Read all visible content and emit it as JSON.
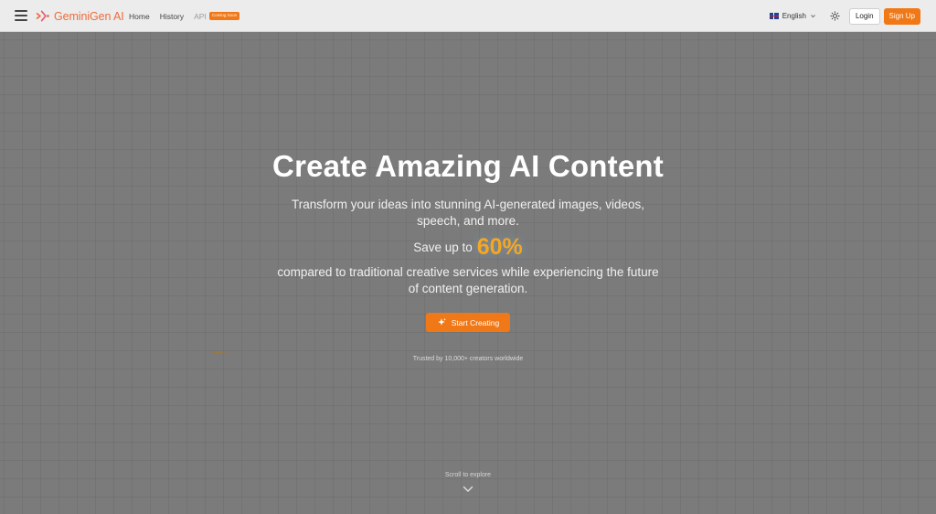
{
  "header": {
    "brand": "GeminiGen AI",
    "nav": [
      {
        "label": "Home"
      },
      {
        "label": "History"
      },
      {
        "label": "API",
        "badge": "Coming Soon"
      }
    ],
    "language": "English",
    "login_label": "Login",
    "signup_label": "Sign Up"
  },
  "hero": {
    "title": "Create Amazing AI Content",
    "subtitle": "Transform your ideas into stunning AI-generated images, videos, speech, and more.",
    "save_prefix": "Save up to",
    "save_percent": "60%",
    "description": "compared to traditional creative services while experiencing the future of content generation.",
    "cta_label": "Start Creating",
    "trusted": "Trusted by 10,000+ creators worldwide",
    "scroll_hint": "Scroll to explore"
  },
  "icons": {
    "menu": "hamburger-icon",
    "logo": "geminigen-logo-icon",
    "flag": "uk-flag-icon",
    "language_chevron": "chevron-down-icon",
    "theme": "sun-icon",
    "cta": "sparkle-icon",
    "scroll": "chevron-down-icon"
  },
  "colors": {
    "accent": "#f07817",
    "brand_text": "#ee6c3b",
    "hero_bg": "#7b7b7b",
    "header_bg": "#ececec",
    "percent": "#f5a623"
  }
}
